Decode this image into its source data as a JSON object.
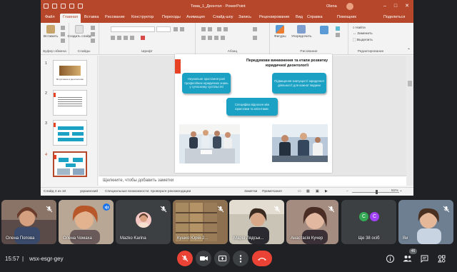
{
  "ppt": {
    "title": "Тема_1_Деонтол  ·  PowerPoint",
    "user": "Olena",
    "tabs": [
      "Файл",
      "Главная",
      "Вставка",
      "Рисование",
      "Конструктор",
      "Переходы",
      "Анимация",
      "Слайд-шоу",
      "Запись",
      "Рецензирование",
      "Вид",
      "Справка",
      "Помощник",
      "Поделиться"
    ],
    "ribbon": {
      "paste": "Вставить",
      "clipboard": "Буфер обмена",
      "new_slide": "Создать слайд",
      "slides": "Слайды",
      "font": "Шрифт",
      "paragraph": "Абзац",
      "shapes": "Фигуры",
      "arrange": "Упорядочить",
      "drawing": "Рисование",
      "find": "Найти",
      "replace": "Заменить",
      "select": "Выделить",
      "editing": "Редактирование"
    },
    "thumbs": [
      {
        "num": "1",
        "label": "Вступление в деонтологию"
      },
      {
        "num": "2",
        "label": ""
      },
      {
        "num": "3",
        "label": ""
      },
      {
        "num": "4",
        "label": ""
      }
    ],
    "slide": {
      "title": "Передумови виникнення та етапи розвитку юридичної деонтології",
      "box1": "Неухильне зростання ролі професійних юридичних знань у сучасному суспільстві",
      "box2": "Підвищення значущості юридичної діяльності для кожної людини",
      "box3": "Специфіка відносин між юристами та клієнтами."
    },
    "notes_placeholder": "Щелкните, чтобы добавить заметки",
    "status": {
      "slide": "Слайд 4 из 10",
      "language": "украинский",
      "accessibility": "Специальные возможности: проверьте рекомендации",
      "notes": "Заметки",
      "comments": "Примечания",
      "zoom": "51%"
    }
  },
  "participants": [
    {
      "name": "Олена Попова",
      "muted": true
    },
    {
      "name": "Олена Чомаха",
      "muted": false,
      "speaking": true
    },
    {
      "name": "Mazko Karina",
      "muted": true
    },
    {
      "name": "Кушко Юрій-2...",
      "muted": true
    },
    {
      "name": "Марія Лядськ...",
      "muted": true
    },
    {
      "name": "Анастасія Кучер",
      "muted": true
    },
    {
      "name": "Ще 38 осіб",
      "muted": false
    },
    {
      "name": "Ви",
      "muted": true
    }
  ],
  "more_initials": [
    "C",
    "C"
  ],
  "meeting": {
    "time": "15:57",
    "separator": "|",
    "code": "wsx-esgr-gey",
    "people_count": "46"
  },
  "colors": {
    "ppt_accent": "#b7472a",
    "slide_shape": "#1ba1c3",
    "hangup": "#ea4335",
    "meet_bg": "#202124"
  }
}
